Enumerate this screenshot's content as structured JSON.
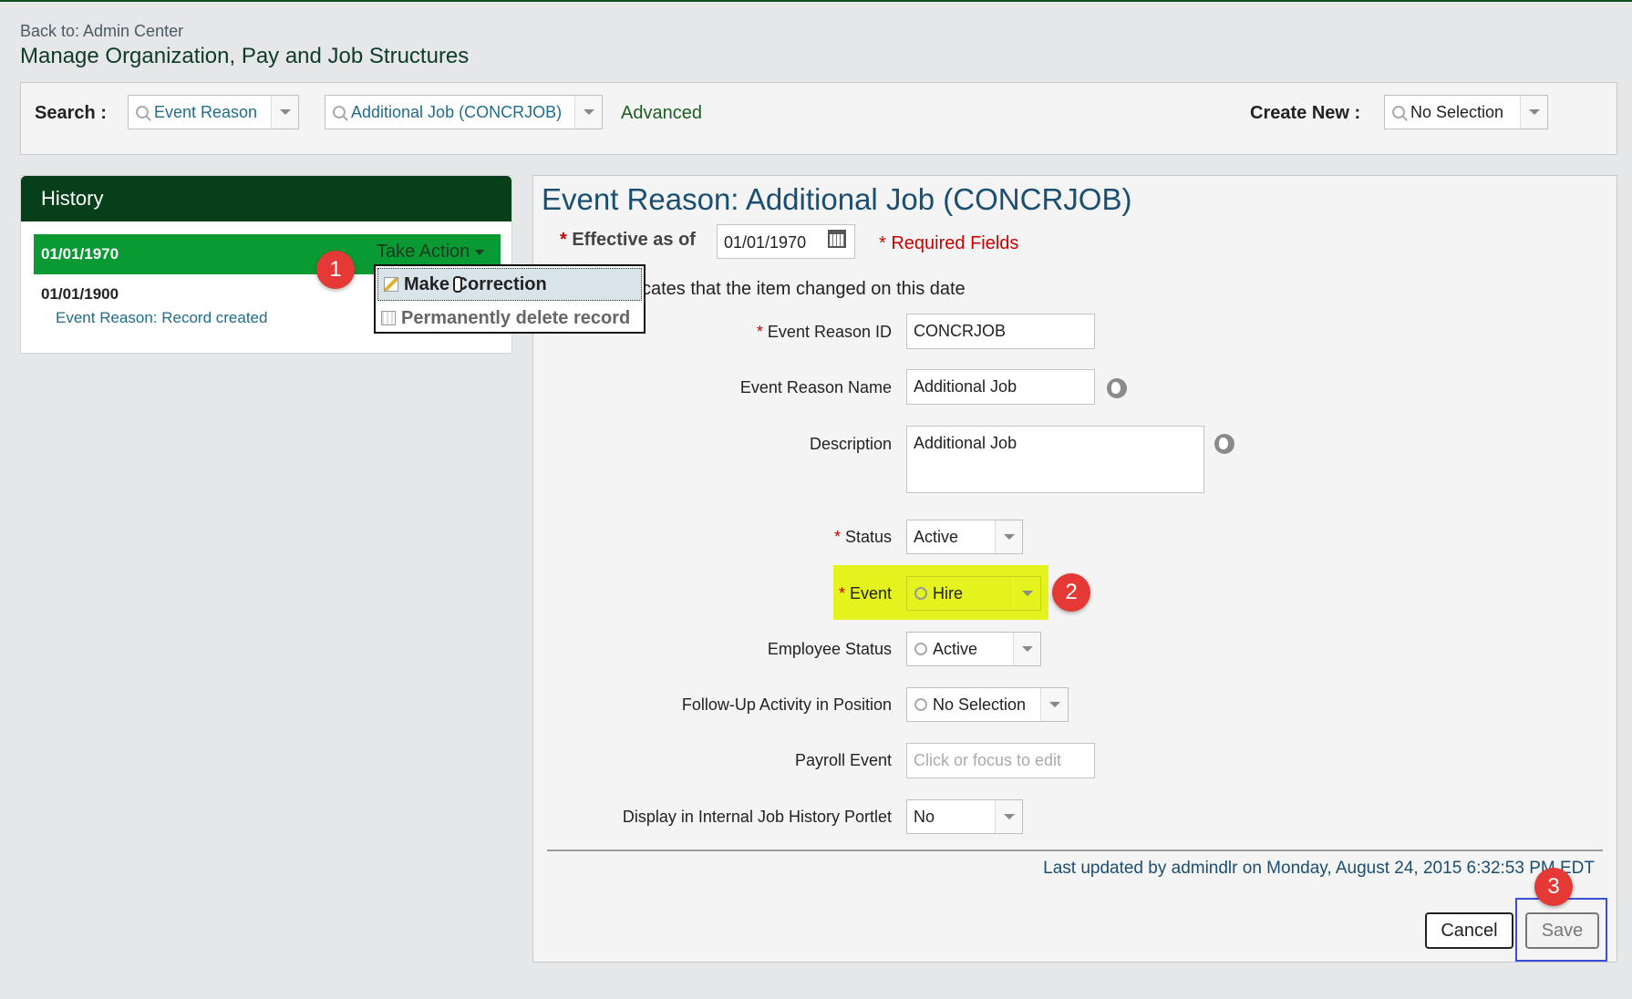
{
  "header": {
    "back_link": "Back to: Admin Center",
    "page_title": "Manage Organization, Pay and Job Structures"
  },
  "search": {
    "label": "Search :",
    "type_value": "Event Reason",
    "record_value": "Additional Job (CONCRJOB)",
    "advanced_label": "Advanced",
    "create_new_label": "Create New :",
    "create_new_value": "No Selection"
  },
  "history": {
    "title": "History",
    "selected_date": "01/01/1970",
    "take_action": "Take Action",
    "older_date": "01/01/1900",
    "older_link": "Event Reason: Record created"
  },
  "menu": {
    "make_correction": "Make Correction",
    "delete_record": "Permanently delete record"
  },
  "form": {
    "title": "Event Reason: Additional Job (CONCRJOB)",
    "effective_label": "Effective as of",
    "effective_value": "01/01/1970",
    "required_fields": "Required Fields",
    "note": "cates that the item changed on this date",
    "event_reason_id_label": "Event Reason ID",
    "event_reason_id_value": "CONCRJOB",
    "event_reason_name_label": "Event Reason Name",
    "event_reason_name_value": "Additional Job",
    "description_label": "Description",
    "description_value": "Additional Job",
    "status_label": "Status",
    "status_value": "Active",
    "event_label": "Event",
    "event_value": "Hire",
    "employee_status_label": "Employee Status",
    "employee_status_value": "Active",
    "followup_label": "Follow-Up Activity in Position",
    "followup_value": "No Selection",
    "payroll_label": "Payroll Event",
    "payroll_placeholder": "Click or focus to edit",
    "display_history_label": "Display in Internal Job History Portlet",
    "display_history_value": "No",
    "last_updated": "Last updated by admindlr on Monday, August 24, 2015 6:32:53 PM EDT",
    "cancel_label": "Cancel",
    "save_label": "Save"
  },
  "badges": {
    "one": "1",
    "two": "2",
    "three": "3"
  },
  "colors": {
    "brand_dark": "#063f1a",
    "brand_green": "#0a9a33",
    "highlight": "#e4f21d",
    "badge": "#e53935",
    "focus_box": "#3a4fd8"
  }
}
